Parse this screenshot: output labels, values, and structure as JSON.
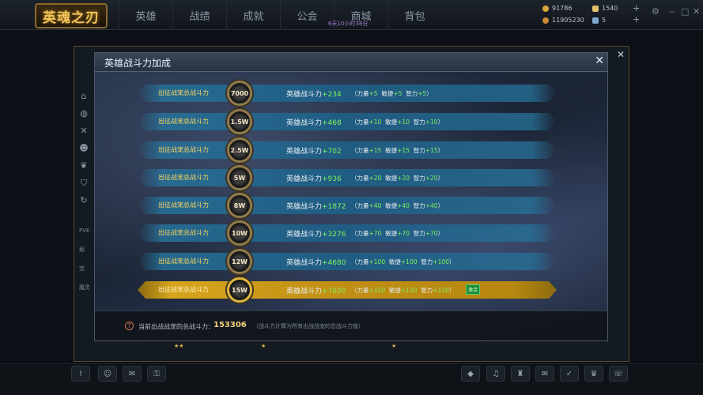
{
  "app": {
    "logo": "英魂之刃"
  },
  "nav": {
    "items": [
      "英雄",
      "战绩",
      "成就",
      "公会",
      "商城",
      "背包"
    ]
  },
  "timer": "6天10小时38分",
  "resources": {
    "gold": "91786",
    "gems": "1540",
    "points": "11905230",
    "tickets": "5"
  },
  "background_window": {
    "left_labels": [
      "PVE",
      "秘",
      "宝",
      "魔灵"
    ]
  },
  "dialog": {
    "title": "英雄战斗力加成",
    "close_label": "✕",
    "rows": [
      {
        "label": "出征战宠总战斗力",
        "badge": "7000",
        "bonus_label": "英雄战斗力",
        "bonus": "+234",
        "str": "+5",
        "agi": "+5",
        "int": "+5",
        "active": false
      },
      {
        "label": "出征战宠总战斗力",
        "badge": "1.5W",
        "bonus_label": "英雄战斗力",
        "bonus": "+468",
        "str": "+10",
        "agi": "+10",
        "int": "+10",
        "active": false
      },
      {
        "label": "出征战宠总战斗力",
        "badge": "2.5W",
        "bonus_label": "英雄战斗力",
        "bonus": "+702",
        "str": "+15",
        "agi": "+15",
        "int": "+15",
        "active": false
      },
      {
        "label": "出征战宠总战斗力",
        "badge": "5W",
        "bonus_label": "英雄战斗力",
        "bonus": "+936",
        "str": "+20",
        "agi": "+20",
        "int": "+20",
        "active": false
      },
      {
        "label": "出征战宠总战斗力",
        "badge": "8W",
        "bonus_label": "英雄战斗力",
        "bonus": "+1872",
        "str": "+40",
        "agi": "+40",
        "int": "+40",
        "active": false
      },
      {
        "label": "出征战宠总战斗力",
        "badge": "10W",
        "bonus_label": "英雄战斗力",
        "bonus": "+3276",
        "str": "+70",
        "agi": "+70",
        "int": "+70",
        "active": false
      },
      {
        "label": "出征战宠总战斗力",
        "badge": "12W",
        "bonus_label": "英雄战斗力",
        "bonus": "+4680",
        "str": "+100",
        "agi": "+100",
        "int": "+100",
        "active": false
      },
      {
        "label": "出征战宠总战斗力",
        "badge": "15W",
        "bonus_label": "英雄战斗力",
        "bonus": "+7020",
        "str": "+150",
        "agi": "+150",
        "int": "+150",
        "active": true,
        "tag": "激活"
      }
    ],
    "stat_labels": {
      "str": "力量",
      "agi": "敏捷",
      "int": "智力"
    },
    "footer": {
      "label": "当前出战战宠的总战斗力：",
      "value": "153306",
      "note": "（战斗力计算为所有出战战宠的总战斗力值）"
    }
  },
  "colors": {
    "accent_gold": "#d7a51c",
    "bonus_green": "#7df05a",
    "row_blue": "#1e5f87"
  }
}
